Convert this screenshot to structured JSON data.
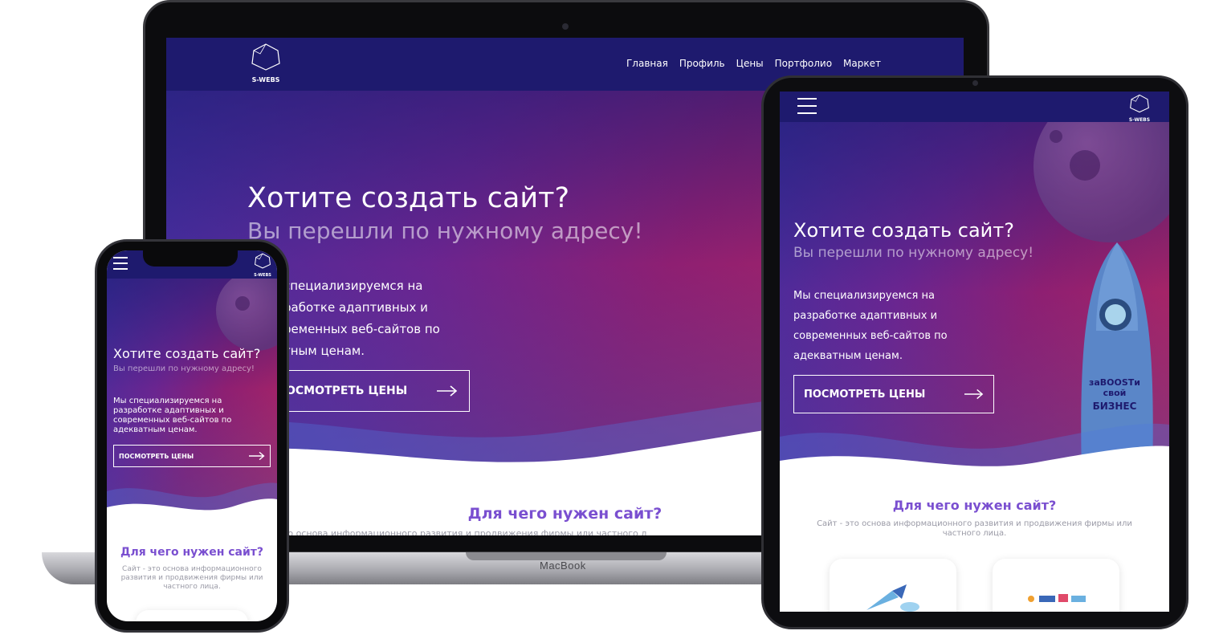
{
  "brand": {
    "logo_text": "S-WEBS"
  },
  "nav": {
    "items": [
      "Главная",
      "Профиль",
      "Цены",
      "Портфолио",
      "Маркет"
    ]
  },
  "hero": {
    "title": "Хотите создать сайт?",
    "subtitle": "Вы перешли по нужному адресу!",
    "desc_laptop": [
      "специализируемся на",
      "работке адаптивных и",
      "ременных веб-сайтов по",
      "тным ценам."
    ],
    "desc_full": [
      "Мы специализируемся на",
      "разработке адаптивных и",
      "современных веб-сайтов по",
      "адекватным ценам."
    ],
    "cta_laptop": "ОСМОТРЕТЬ ЦЕНЫ",
    "cta": "ПОСМОТРЕТЬ ЦЕНЫ",
    "rocket_text_1": "заBOOSTи свой",
    "rocket_text_2": "БИЗНЕС"
  },
  "section": {
    "title": "Для чего нужен сайт?",
    "text_laptop": "Сайт - это основа информационного развития и продвижения фирмы или частного л",
    "text_tablet": [
      "Сайт - это основа информационного развития и продвижения фирмы или",
      "частного лица."
    ],
    "text_phone": [
      "Сайт - это основа информационного",
      "развития и продвижения фирмы или",
      "частного лица."
    ]
  },
  "device": {
    "laptop_label": "MacBook"
  },
  "colors": {
    "header": "#1e1a6e",
    "accent": "#7a4fd0",
    "gradient_start": "#3e2fa0",
    "gradient_end": "#b5285f"
  },
  "icons": [
    "logo-polyhedron-icon",
    "hamburger-menu-icon",
    "arrow-right-icon",
    "rocket-icon",
    "planet-icon"
  ]
}
